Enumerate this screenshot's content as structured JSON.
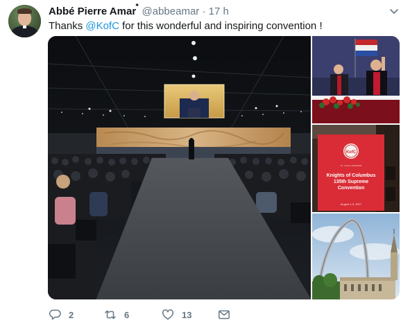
{
  "tweet": {
    "display_name": "Abbé Pierre Amar",
    "name_suffix": " ๋",
    "handle": "@abbeamar",
    "separator": " · ",
    "time": "17 h",
    "text_before": "Thanks ",
    "mention": "@KofC",
    "text_after": " for this wonderful and inspiring convention !",
    "media": {
      "banner_title": "Knights of Columbus 135th Supreme Convention",
      "banner_title_lines": [
        "Knights of Columbus",
        "135th Supreme",
        "Convention"
      ],
      "banner_subtitle": "ST. LOUIS, MISSOURI",
      "banner_date": "August 1-3, 2017"
    },
    "actions": {
      "replies": "2",
      "retweets": "6",
      "likes": "13"
    }
  },
  "icons": {
    "reply": "reply-icon",
    "retweet": "retweet-icon",
    "like": "heart-icon",
    "dm": "envelope-icon",
    "more": "chevron-down-icon"
  },
  "colors": {
    "link": "#1b95e0",
    "muted": "#657786",
    "text": "#14171a"
  }
}
